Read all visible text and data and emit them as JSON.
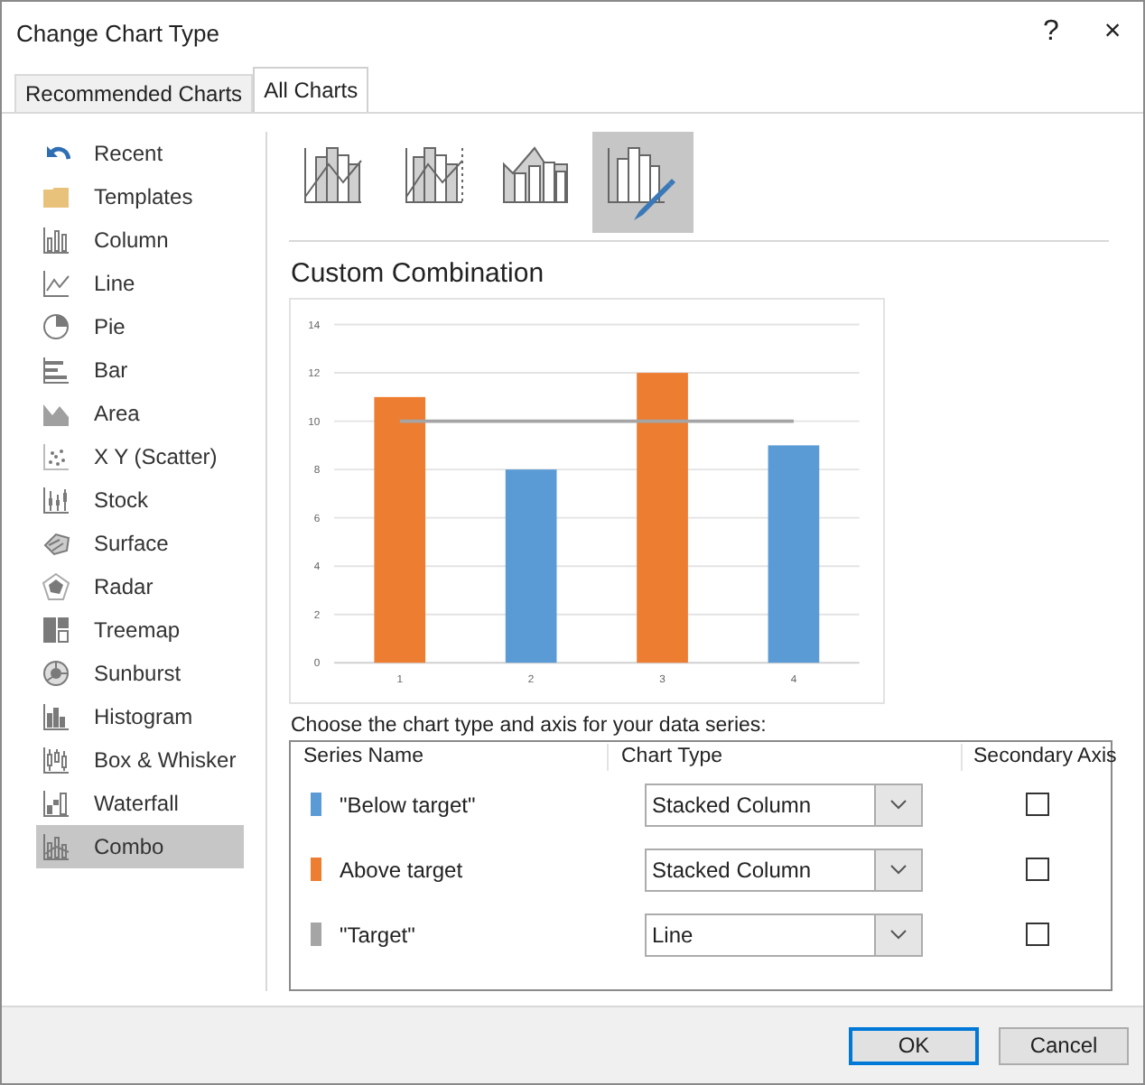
{
  "window": {
    "title": "Change Chart Type",
    "help": "?",
    "close": "×"
  },
  "tabs": [
    {
      "label": "Recommended Charts",
      "selected": false
    },
    {
      "label": "All Charts",
      "selected": true
    }
  ],
  "sidebar": {
    "items": [
      {
        "label": "Recent",
        "selected": false
      },
      {
        "label": "Templates",
        "selected": false
      },
      {
        "label": "Column",
        "selected": false
      },
      {
        "label": "Line",
        "selected": false
      },
      {
        "label": "Pie",
        "selected": false
      },
      {
        "label": "Bar",
        "selected": false
      },
      {
        "label": "Area",
        "selected": false
      },
      {
        "label": "X Y (Scatter)",
        "selected": false
      },
      {
        "label": "Stock",
        "selected": false
      },
      {
        "label": "Surface",
        "selected": false
      },
      {
        "label": "Radar",
        "selected": false
      },
      {
        "label": "Treemap",
        "selected": false
      },
      {
        "label": "Sunburst",
        "selected": false
      },
      {
        "label": "Histogram",
        "selected": false
      },
      {
        "label": "Box & Whisker",
        "selected": false
      },
      {
        "label": "Waterfall",
        "selected": false
      },
      {
        "label": "Combo",
        "selected": true
      }
    ]
  },
  "subtypes": [
    {
      "selected": false
    },
    {
      "selected": false
    },
    {
      "selected": false
    },
    {
      "selected": true
    }
  ],
  "preview": {
    "title": "Custom Combination",
    "chart_data": {
      "type": "bar",
      "stacked": true,
      "grid": true,
      "categories": [
        "1",
        "2",
        "3",
        "4"
      ],
      "ylim": [
        0,
        14
      ],
      "yticks": [
        0,
        2,
        4,
        6,
        8,
        10,
        12,
        14
      ],
      "series": [
        {
          "color": "#5b9bd5",
          "type": "bar",
          "values": [
            null,
            8,
            null,
            9
          ]
        },
        {
          "color": "#ed7d31",
          "type": "bar",
          "values": [
            11,
            null,
            12,
            null
          ]
        },
        {
          "color": "#a5a5a5",
          "type": "line",
          "values": [
            10,
            10,
            10,
            10
          ]
        }
      ]
    }
  },
  "series_table": {
    "caption": "Choose the chart type and axis for your data series:",
    "columns": [
      "Series Name",
      "Chart Type",
      "Secondary Axis"
    ],
    "rows": [
      {
        "name": "\"Below target\"",
        "color": "#5b9bd5",
        "chart_type": "Stacked Column",
        "secondary_axis": false
      },
      {
        "name": "Above target",
        "color": "#ed7d31",
        "chart_type": "Stacked Column",
        "secondary_axis": false
      },
      {
        "name": "\"Target\"",
        "color": "#a5a5a5",
        "chart_type": "Line",
        "secondary_axis": false
      }
    ]
  },
  "buttons": [
    "OK",
    "Cancel"
  ]
}
